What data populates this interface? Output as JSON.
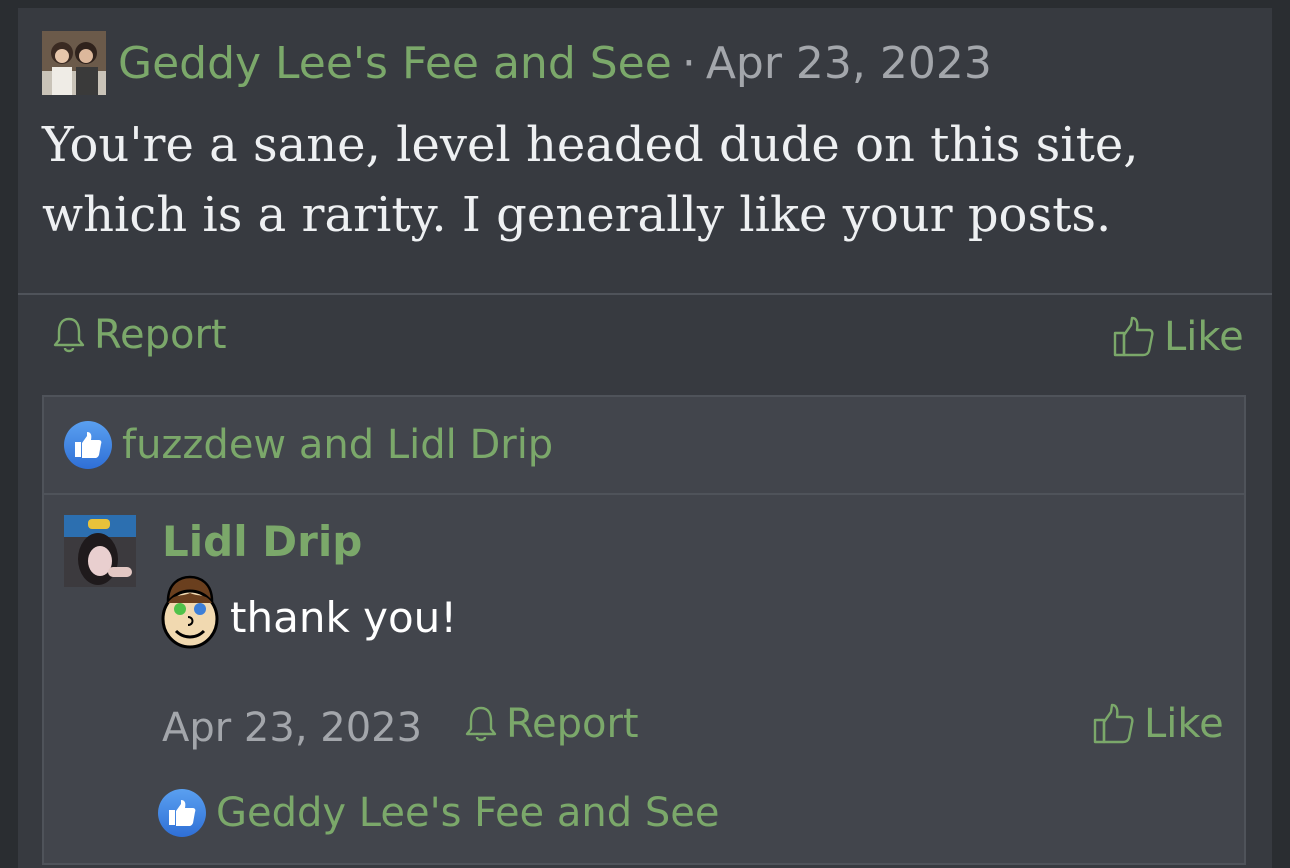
{
  "post": {
    "author": "Geddy Lee's Fee and See",
    "separator": "·",
    "date": "Apr 23, 2023",
    "body": "You're a sane, level headed dude on this site, which is a rarity. I generally like your posts.",
    "report_label": "Report",
    "like_label": "Like",
    "reactions_text": "fuzzdew and Lidl Drip"
  },
  "reply": {
    "author": "Lidl Drip",
    "text": "thank you!",
    "date": "Apr 23, 2023",
    "report_label": "Report",
    "like_label": "Like",
    "reactions_text": "Geddy Lee's Fee and See"
  },
  "colors": {
    "accent": "#7ba86a",
    "card_bg": "#373a40",
    "reply_bg": "#42454c",
    "muted": "#a3a6ab"
  }
}
